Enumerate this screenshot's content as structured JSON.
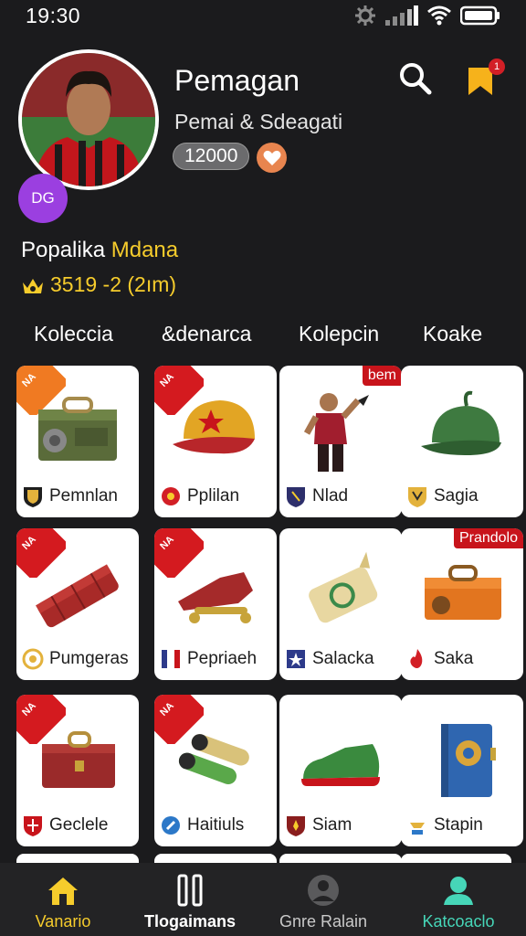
{
  "status": {
    "time": "19:30"
  },
  "profile": {
    "name": "Pemagan",
    "subtitle": "Pemai & Sdeagati",
    "coins": "12000",
    "avatar_badge": "DG",
    "notification_count": "1"
  },
  "featured": {
    "title_prefix": "Popalika",
    "title_highlight": "Mdana",
    "stats": "3519 -2  (2ım)"
  },
  "tabs": [
    "Koleccia",
    "&denarca",
    "Kolepcin",
    "Koake"
  ],
  "items": [
    {
      "label": "Pemnlan",
      "ribbon": "NA",
      "tag": ""
    },
    {
      "label": "Pplilan",
      "ribbon": "NA",
      "tag": ""
    },
    {
      "label": "Nlad",
      "ribbon": "",
      "tag": "bem"
    },
    {
      "label": "Sagia",
      "ribbon": "",
      "tag": ""
    },
    {
      "label": "Pumgeras",
      "ribbon": "NA",
      "tag": ""
    },
    {
      "label": "Pepriaeh",
      "ribbon": "NA",
      "tag": ""
    },
    {
      "label": "Salacka",
      "ribbon": "",
      "tag": ""
    },
    {
      "label": "Saka",
      "ribbon": "",
      "tag": "Prandolo"
    },
    {
      "label": "Geclele",
      "ribbon": "NA",
      "tag": ""
    },
    {
      "label": "Haitiuls",
      "ribbon": "NA",
      "tag": ""
    },
    {
      "label": "Siam",
      "ribbon": "",
      "tag": ""
    },
    {
      "label": "Stapin",
      "ribbon": "",
      "tag": ""
    }
  ],
  "nav": [
    {
      "label": "Vanario",
      "color": "#f6cc2c",
      "icon": "home-icon"
    },
    {
      "label": "Tlogaimans",
      "color": "#ffffff",
      "icon": "pause-icon"
    },
    {
      "label": "Gnre Ralain",
      "color": "#c9c9c9",
      "icon": "game-icon"
    },
    {
      "label": "Katcoaclo",
      "color": "#46d6b8",
      "icon": "profile-icon"
    }
  ],
  "colors": {
    "accent": "#f6cc2c",
    "background": "#1b1b1d",
    "ribbon_red": "#d41a1f",
    "ribbon_orange": "#f07a22"
  }
}
